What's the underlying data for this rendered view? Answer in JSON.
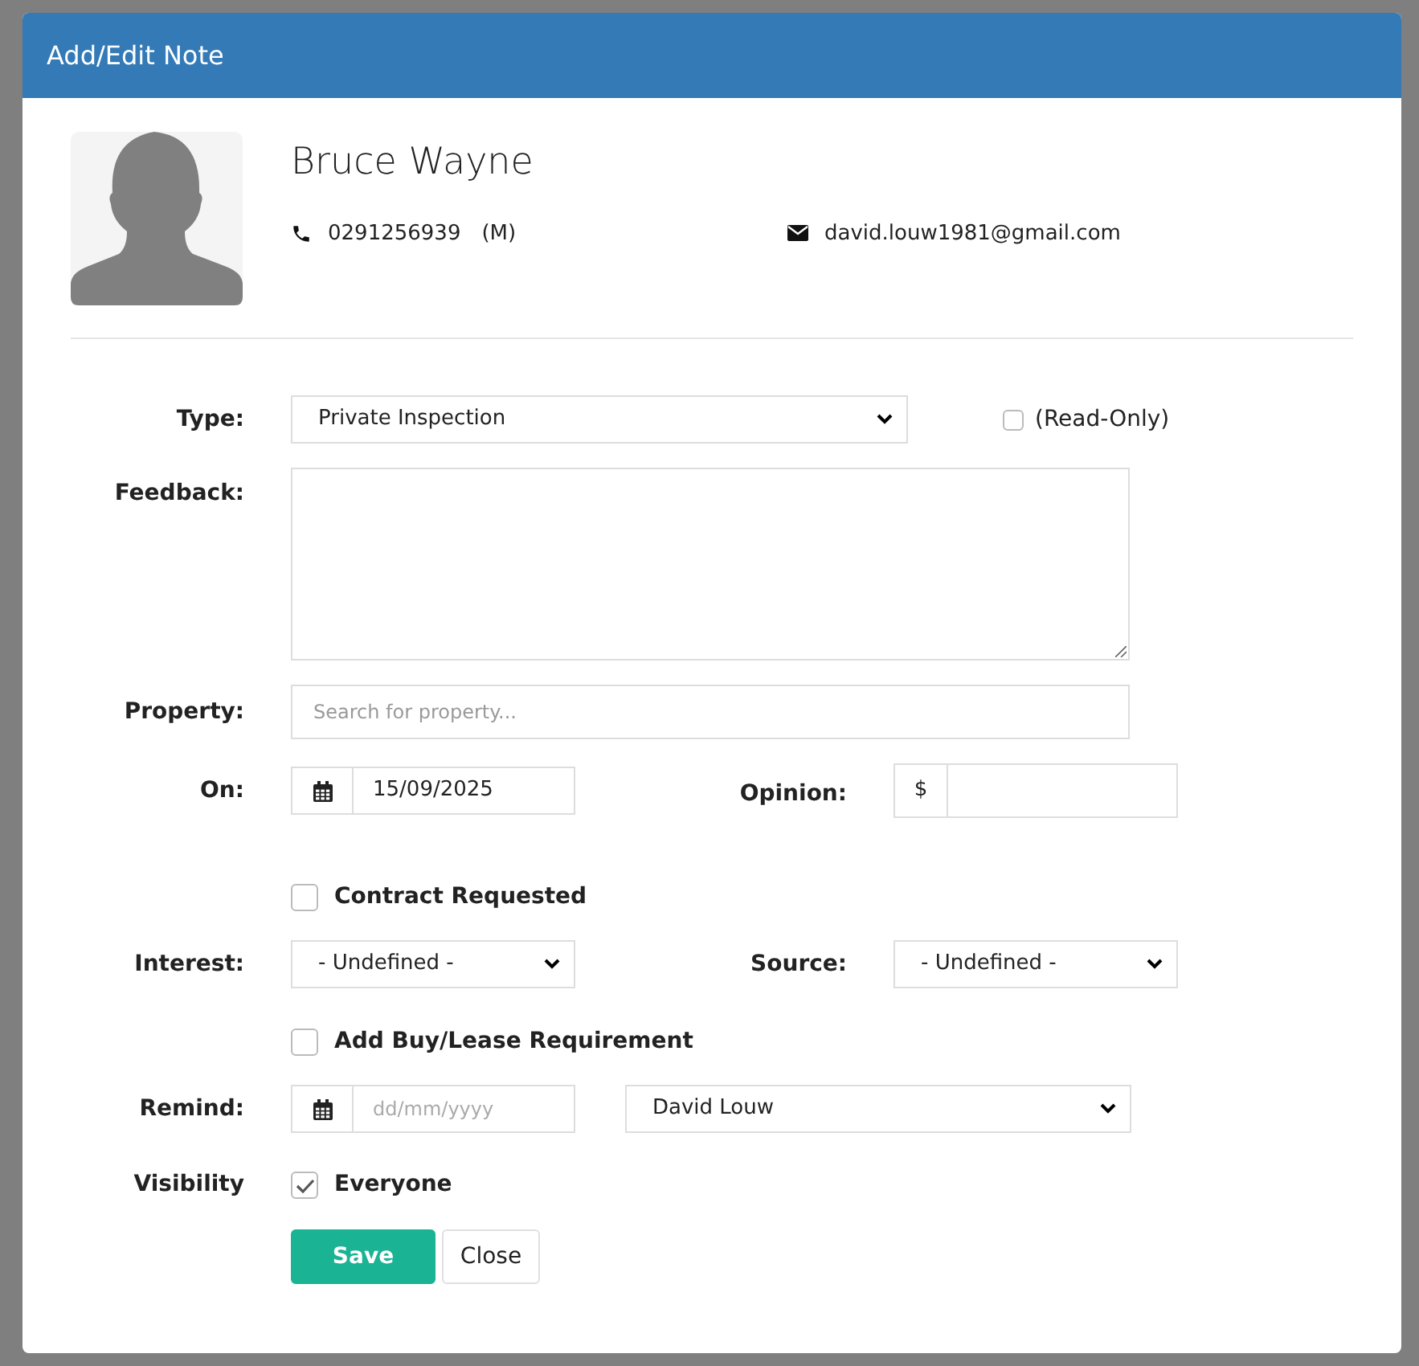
{
  "dialog": {
    "title": "Add/Edit Note"
  },
  "contact": {
    "name": "Bruce Wayne",
    "phone": "0291256939",
    "phone_type": "(M)",
    "email": "david.louw1981@gmail.com"
  },
  "form": {
    "type": {
      "label": "Type:",
      "value": "Private Inspection",
      "read_only": {
        "label": "(Read-Only)",
        "checked": false
      }
    },
    "feedback": {
      "label": "Feedback:"
    },
    "property": {
      "label": "Property:",
      "placeholder": "Search for property..."
    },
    "on": {
      "label": "On:",
      "value": "15/09/2025"
    },
    "opinion": {
      "label": "Opinion:",
      "prefix": "$"
    },
    "contract_requested": {
      "label": "Contract Requested",
      "checked": false
    },
    "interest": {
      "label": "Interest:",
      "value": "- Undefined -"
    },
    "source": {
      "label": "Source:",
      "value": "- Undefined -"
    },
    "requirement": {
      "label": "Add Buy/Lease Requirement",
      "checked": false
    },
    "remind": {
      "label": "Remind:",
      "placeholder": "dd/mm/yyyy",
      "user": "David Louw"
    },
    "visibility": {
      "label": "Visibility",
      "option": {
        "label": "Everyone",
        "checked": true
      }
    }
  },
  "buttons": [
    {
      "label": "Save",
      "kind": "primary"
    },
    {
      "label": "Close",
      "kind": "default"
    }
  ]
}
